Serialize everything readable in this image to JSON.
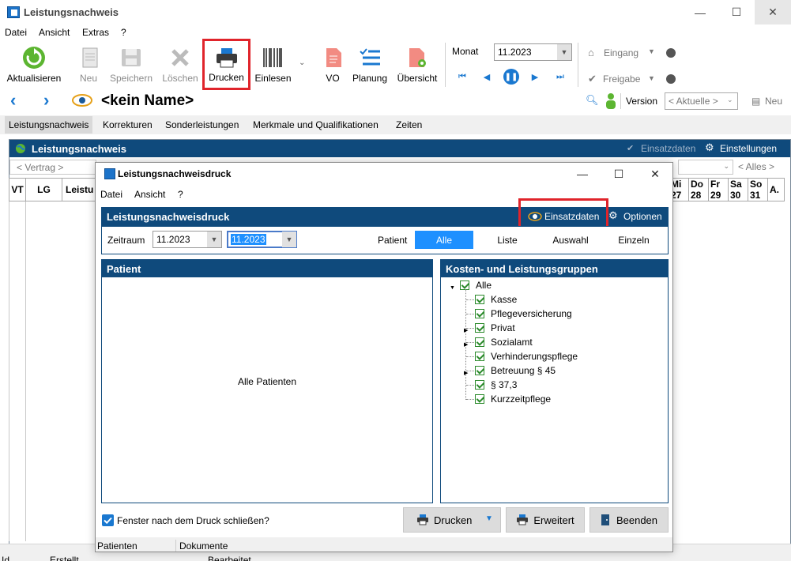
{
  "app": {
    "title": "Leistungsnachweis"
  },
  "window_controls": {
    "minimize": "—",
    "maximize": "☐",
    "close": "✕"
  },
  "menu": [
    "Datei",
    "Ansicht",
    "Extras",
    "?"
  ],
  "toolbar": {
    "aktualisieren": "Aktualisieren",
    "neu": "Neu",
    "speichern": "Speichern",
    "loeschen": "Löschen",
    "drucken": "Drucken",
    "einlesen": "Einlesen",
    "vo": "VO",
    "planung": "Planung",
    "uebersicht": "Übersicht",
    "monat_label": "Monat",
    "monat_value": "11.2023",
    "eingang": "Eingang",
    "freigabe": "Freigabe"
  },
  "nav": {
    "patient_name": "<kein Name>",
    "version_label": "Version",
    "version_value": "< Aktuelle >",
    "neu": "Neu"
  },
  "tabs": [
    "Leistungsnachweis",
    "Korrekturen",
    "Sonderleistungen",
    "Merkmale und Qualifikationen",
    "Zeiten"
  ],
  "main": {
    "header": "Leistungsnachweis",
    "einsatzdaten": "Einsatzdaten",
    "einstellungen": "Einstellungen",
    "vertrag_filter": "< Vertrag >",
    "alles_filter": "< Alles >",
    "columns": [
      "VT",
      "LG",
      "Leistu"
    ],
    "days": [
      {
        "d": "Mi",
        "n": "27"
      },
      {
        "d": "Do",
        "n": "28"
      },
      {
        "d": "Fr",
        "n": "29"
      },
      {
        "d": "Sa",
        "n": "30"
      },
      {
        "d": "So",
        "n": "31"
      },
      {
        "d": "A.",
        "n": ""
      }
    ]
  },
  "statusbar": {
    "id": "Id",
    "erstellt": "Erstellt",
    "bearbeitet": "Bearbeitet"
  },
  "dialog": {
    "title": "Leistungsnachweisdruck",
    "menu": [
      "Datei",
      "Ansicht",
      "?"
    ],
    "header": "Leistungsnachweisdruck",
    "einsatzdaten": "Einsatzdaten",
    "optionen": "Optionen",
    "zeitraum_label": "Zeitraum",
    "zeitraum_from": "11.2023",
    "zeitraum_to": "11.2023",
    "patient_label": "Patient",
    "patient_options": [
      "Alle",
      "Liste",
      "Auswahl",
      "Einzeln"
    ],
    "patient_panel_header": "Patient",
    "patient_panel_text": "Alle Patienten",
    "kosten_header": "Kosten- und Leistungsgruppen",
    "tree_root": "Alle",
    "tree_items": [
      "Kasse",
      "Pflegeversicherung",
      "Privat",
      "Sozialamt",
      "Verhinderungspflege",
      "Betreuung § 45",
      "§ 37,3",
      "Kurzzeitpflege"
    ],
    "close_after_print": "Fenster nach dem Druck schließen?",
    "btn_drucken": "Drucken",
    "btn_erweitert": "Erweitert",
    "btn_beenden": "Beenden",
    "status_patienten": "Patienten",
    "status_dokumente": "Dokumente"
  },
  "colors": {
    "header_blue": "#0f4a7c",
    "highlight_red": "#e0242b",
    "accent_blue": "#1a78d0",
    "selected_blue": "#1e90ff",
    "check_green": "#2b8a2b"
  }
}
